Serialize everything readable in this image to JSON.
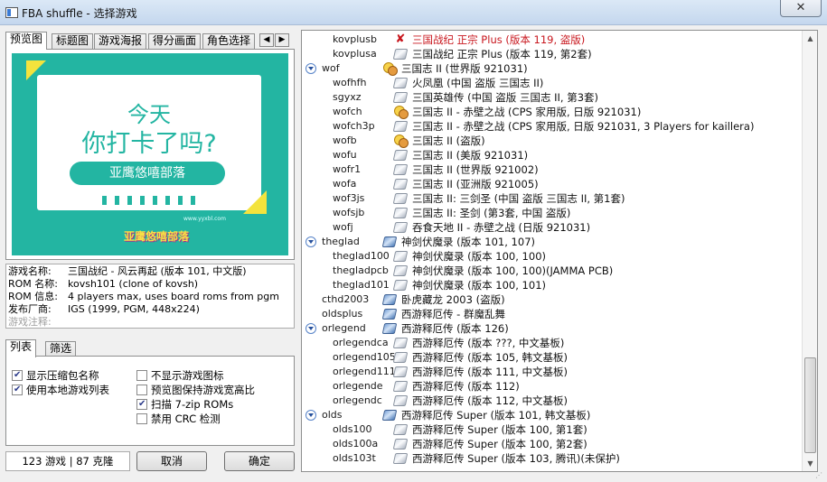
{
  "window": {
    "title": "FBA shuffle - 选择游戏",
    "close_label": "✕"
  },
  "tabs": [
    "预览图",
    "标题图",
    "游戏海报",
    "得分画面",
    "角色选择"
  ],
  "tab_arrows": {
    "left": "◀",
    "right": "▶"
  },
  "preview": {
    "line1": "今天",
    "line2": "你打卡了吗?",
    "pill": "亚鹰悠嘻部落",
    "url": "www.yyxbl.com",
    "logo": "亚鹰悠嘻部落"
  },
  "info": [
    {
      "label": "游戏名称:",
      "value": "三国战纪 - 风云再起 (版本 101, 中文版)"
    },
    {
      "label": "ROM 名称:",
      "value": "kovsh101 (clone of kovsh)"
    },
    {
      "label": "ROM 信息:",
      "value": "4 players max, uses board roms from pgm"
    },
    {
      "label": "发布厂商:",
      "value": "IGS (1999, PGM, 448x224)"
    },
    {
      "label": "游戏注释:",
      "value": ""
    }
  ],
  "list_tabs": [
    "列表",
    "筛选"
  ],
  "options": [
    {
      "label": "显示压缩包名称",
      "checked": true
    },
    {
      "label": "使用本地游戏列表",
      "checked": true
    },
    {
      "label": "不显示游戏图标",
      "checked": false
    },
    {
      "label": "预览图保持游戏宽高比",
      "checked": false
    },
    {
      "label": "扫描 7-zip ROMs",
      "checked": true
    },
    {
      "label": "禁用 CRC 检测",
      "checked": false
    }
  ],
  "status": "123 游戏 | 87 克隆",
  "buttons": {
    "cancel": "取消",
    "ok": "确定"
  },
  "tree_rows": [
    {
      "rom": "kovplusb",
      "name": "三国战纪 正宗 Plus (版本 119, 盗版)",
      "icon": "cross",
      "level": 1,
      "selected": true
    },
    {
      "rom": "kovplusa",
      "name": "三国战纪 正宗 Plus (版本 119, 第2套)",
      "icon": "disc",
      "level": 1
    },
    {
      "rom": "wof",
      "name": "三国志 II (世界版 921031)",
      "icon": "face",
      "level": 0,
      "expanded": true
    },
    {
      "rom": "wofhfh",
      "name": "火凤凰 (中国 盗版 三国志 II)",
      "icon": "disc",
      "level": 1
    },
    {
      "rom": "sgyxz",
      "name": "三国英雄传 (中国 盗版 三国志 II, 第3套)",
      "icon": "disc",
      "level": 1
    },
    {
      "rom": "wofch",
      "name": "三国志 II - 赤壁之战 (CPS 家用版, 日版 921031)",
      "icon": "face",
      "level": 1
    },
    {
      "rom": "wofch3p",
      "name": "三国志 II - 赤壁之战 (CPS 家用版, 日版 921031, 3 Players for kaillera)",
      "icon": "disc",
      "level": 1
    },
    {
      "rom": "wofb",
      "name": "三国志 II (盗版)",
      "icon": "face",
      "level": 1
    },
    {
      "rom": "wofu",
      "name": "三国志 II (美版 921031)",
      "icon": "disc",
      "level": 1
    },
    {
      "rom": "wofr1",
      "name": "三国志 II (世界版 921002)",
      "icon": "disc",
      "level": 1
    },
    {
      "rom": "wofa",
      "name": "三国志 II (亚洲版 921005)",
      "icon": "disc",
      "level": 1
    },
    {
      "rom": "wof3js",
      "name": "三国志 II: 三剑圣 (中国 盗版 三国志 II, 第1套)",
      "icon": "disc",
      "level": 1
    },
    {
      "rom": "wofsjb",
      "name": "三国志 II: 圣剑 (第3套, 中国 盗版)",
      "icon": "disc",
      "level": 1
    },
    {
      "rom": "wofj",
      "name": "吞食天地 II - 赤壁之战 (日版 921031)",
      "icon": "disc",
      "level": 1
    },
    {
      "rom": "theglad",
      "name": "神剑伏魔录 (版本 101, 107)",
      "icon": "disc-blue",
      "level": 0,
      "expanded": true
    },
    {
      "rom": "theglad100",
      "name": "神剑伏魔录 (版本 100, 100)",
      "icon": "disc",
      "level": 1
    },
    {
      "rom": "thegladpcb",
      "name": "神剑伏魔录 (版本 100, 100)(JAMMA PCB)",
      "icon": "disc",
      "level": 1
    },
    {
      "rom": "theglad101",
      "name": "神剑伏魔录 (版本 100, 101)",
      "icon": "disc",
      "level": 1
    },
    {
      "rom": "cthd2003",
      "name": "卧虎藏龙 2003 (盗版)",
      "icon": "disc-blue",
      "level": 0
    },
    {
      "rom": "oldsplus",
      "name": "西游释厄传 - 群魔乱舞",
      "icon": "disc-blue",
      "level": 0
    },
    {
      "rom": "orlegend",
      "name": "西游释厄传 (版本 126)",
      "icon": "disc-blue",
      "level": 0,
      "expanded": true
    },
    {
      "rom": "orlegendca",
      "name": "西游释厄传 (版本 ???, 中文基板)",
      "icon": "disc",
      "level": 1
    },
    {
      "rom": "orlegend105k",
      "name": "西游释厄传 (版本 105, 韩文基板)",
      "icon": "disc",
      "level": 1
    },
    {
      "rom": "orlegend111c",
      "name": "西游释厄传 (版本 111, 中文基板)",
      "icon": "disc",
      "level": 1
    },
    {
      "rom": "orlegende",
      "name": "西游释厄传 (版本 112)",
      "icon": "disc",
      "level": 1
    },
    {
      "rom": "orlegendc",
      "name": "西游释厄传 (版本 112, 中文基板)",
      "icon": "disc",
      "level": 1
    },
    {
      "rom": "olds",
      "name": "西游释厄传 Super (版本 101, 韩文基板)",
      "icon": "disc-blue",
      "level": 0,
      "expanded": true
    },
    {
      "rom": "olds100",
      "name": "西游释厄传 Super (版本 100, 第1套)",
      "icon": "disc",
      "level": 1
    },
    {
      "rom": "olds100a",
      "name": "西游释厄传 Super (版本 100, 第2套)",
      "icon": "disc",
      "level": 1
    },
    {
      "rom": "olds103t",
      "name": "西游释厄传 Super (版本 103, 腾讯)(未保护)",
      "icon": "disc",
      "level": 1
    }
  ],
  "colors": {
    "accent": "#23b5a2",
    "selected_text": "#c8161d",
    "highlight": "#f3e33d"
  }
}
